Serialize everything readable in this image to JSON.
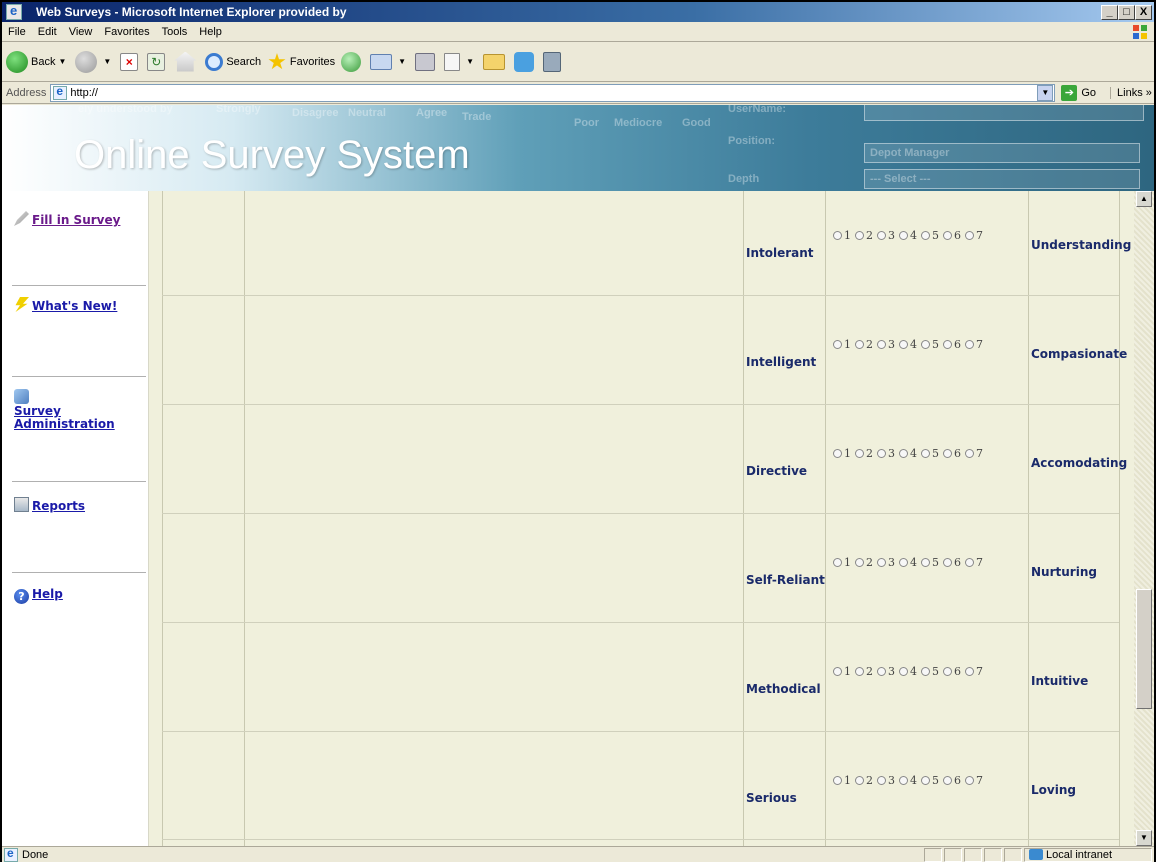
{
  "window": {
    "title": "Web Surveys - Microsoft Internet Explorer provided by",
    "controls": [
      "_",
      "□",
      "X"
    ]
  },
  "menu": [
    "File",
    "Edit",
    "View",
    "Favorites",
    "Tools",
    "Help"
  ],
  "toolbar": {
    "back": "Back",
    "search": "Search",
    "favorites": "Favorites"
  },
  "address": {
    "label": "Address",
    "value": "http://",
    "go": "Go",
    "links": "Links"
  },
  "banner": {
    "title": "Online Survey System",
    "ghost_texts": [
      "ely understood by",
      "Strongly",
      "Disagree",
      "Neutral",
      "Agree",
      "Trade",
      "Poor",
      "Mediocre",
      "Good",
      "UserName:",
      "Position:",
      "Depth",
      "Depot Manager",
      "--- Select ---"
    ]
  },
  "nav": [
    {
      "label": "Fill in Survey",
      "icon": "pencil-icon"
    },
    {
      "label": "What's New!",
      "icon": "lightning-icon"
    },
    {
      "label": "Survey Administration",
      "icon": "admin-icon"
    },
    {
      "label": "Reports",
      "icon": "report-icon"
    },
    {
      "label": "Help",
      "icon": "help-icon"
    }
  ],
  "survey": {
    "scale": [
      "1",
      "2",
      "3",
      "4",
      "5",
      "6",
      "7"
    ],
    "rows": [
      {
        "left": "Intolerant",
        "right": "Understanding"
      },
      {
        "left": "Intelligent",
        "right": "Compasionate"
      },
      {
        "left": "Directive",
        "right": "Accomodating"
      },
      {
        "left": "Self-Reliant",
        "right": "Nurturing"
      },
      {
        "left": "Methodical",
        "right": "Intuitive"
      },
      {
        "left": "Serious",
        "right": "Loving"
      }
    ]
  },
  "status": {
    "text": "Done",
    "zone": "Local intranet"
  }
}
